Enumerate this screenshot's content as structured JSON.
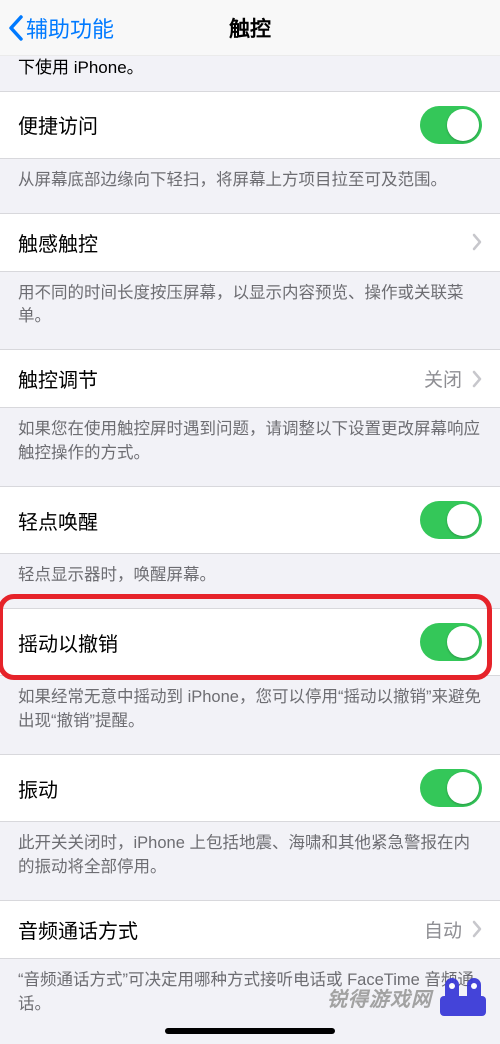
{
  "nav": {
    "back_label": "辅助功能",
    "title": "触控"
  },
  "partial_caption": "下使用 iPhone。",
  "rows": {
    "reachability": {
      "label": "便捷访问"
    },
    "reachability_caption": "从屏幕底部边缘向下轻扫，将屏幕上方项目拉至可及范围。",
    "haptic_touch": {
      "label": "触感触控"
    },
    "haptic_touch_caption": "用不同的时间长度按压屏幕，以显示内容预览、操作或关联菜单。",
    "touch_accom": {
      "label": "触控调节",
      "value": "关闭"
    },
    "touch_accom_caption": "如果您在使用触控屏时遇到问题，请调整以下设置更改屏幕响应触控操作的方式。",
    "tap_to_wake": {
      "label": "轻点唤醒"
    },
    "tap_to_wake_caption": "轻点显示器时，唤醒屏幕。",
    "shake_undo": {
      "label": "摇动以撤销"
    },
    "shake_undo_caption": "如果经常无意中摇动到 iPhone，您可以停用“摇动以撤销”来避免出现“撤销”提醒。",
    "vibration": {
      "label": "振动"
    },
    "vibration_caption": "此开关关闭时，iPhone 上包括地震、海啸和其他紧急警报在内的振动将全部停用。",
    "call_audio": {
      "label": "音频通话方式",
      "value": "自动"
    },
    "call_audio_caption": "“音频通话方式”可决定用哪种方式接听电话或 FaceTime 音频通话。"
  },
  "watermark_text": "锐得游戏网"
}
